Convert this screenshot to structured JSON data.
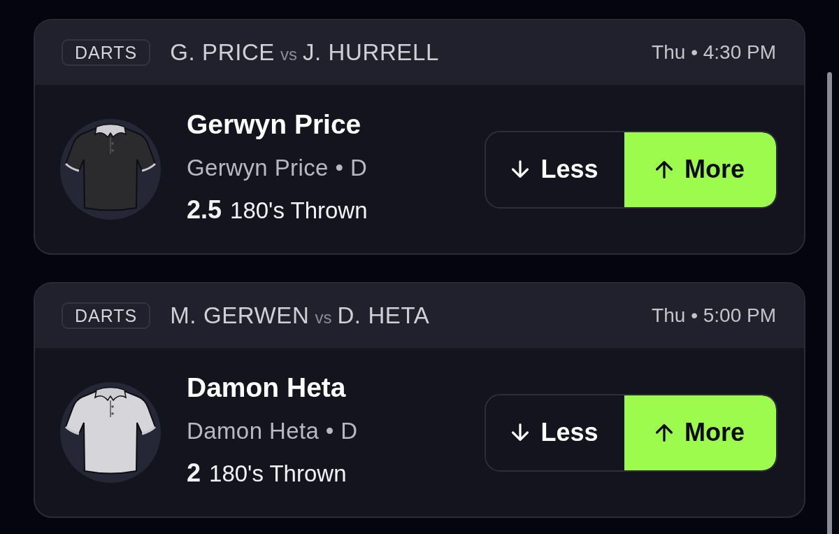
{
  "picks": [
    {
      "sport": "DARTS",
      "matchup": {
        "home": "G. PRICE",
        "separator": "vs",
        "away": "J. HURRELL"
      },
      "time": "Thu • 4:30 PM",
      "player": "Gerwyn Price",
      "detail": "Gerwyn Price • D",
      "line": "2.5",
      "stat": "180's Thrown",
      "jersey": {
        "color": "#2b2b2d"
      },
      "options": [
        {
          "label": "Less",
          "kind": "down",
          "selected": false
        },
        {
          "label": "More",
          "kind": "up",
          "selected": true
        }
      ]
    },
    {
      "sport": "DARTS",
      "matchup": {
        "home": "M. GERWEN",
        "separator": "vs",
        "away": "D. HETA"
      },
      "time": "Thu • 5:00 PM",
      "player": "Damon Heta",
      "detail": "Damon Heta • D",
      "line": "2",
      "stat": "180's Thrown",
      "jersey": {
        "color": "#d6d6da"
      },
      "options": [
        {
          "label": "Less",
          "kind": "down",
          "selected": false
        },
        {
          "label": "More",
          "kind": "up",
          "selected": true
        }
      ]
    }
  ]
}
